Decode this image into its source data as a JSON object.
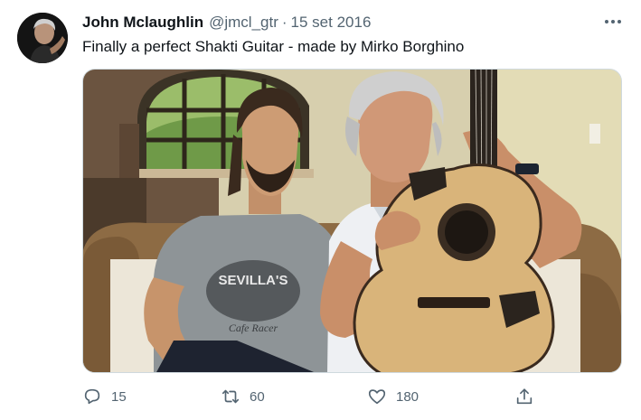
{
  "tweet": {
    "display_name": "John Mclaughlin",
    "handle": "@jmcl_gtr",
    "separator": "·",
    "timestamp": "15 set 2016",
    "text": "Finally a perfect Shakti Guitar - made by Mirko Borghino"
  },
  "media": {
    "shirt_print": [
      "SEVILLA'S",
      "Cafe Racer"
    ]
  },
  "actions": {
    "replies": "15",
    "retweets": "60",
    "likes": "180"
  },
  "icons": {
    "more": "more-horizontal-icon",
    "reply": "reply-icon",
    "retweet": "retweet-icon",
    "like": "heart-icon",
    "share": "share-icon"
  },
  "colors": {
    "text": "#0f1419",
    "secondary": "#536471",
    "border": "#cfd9de"
  }
}
